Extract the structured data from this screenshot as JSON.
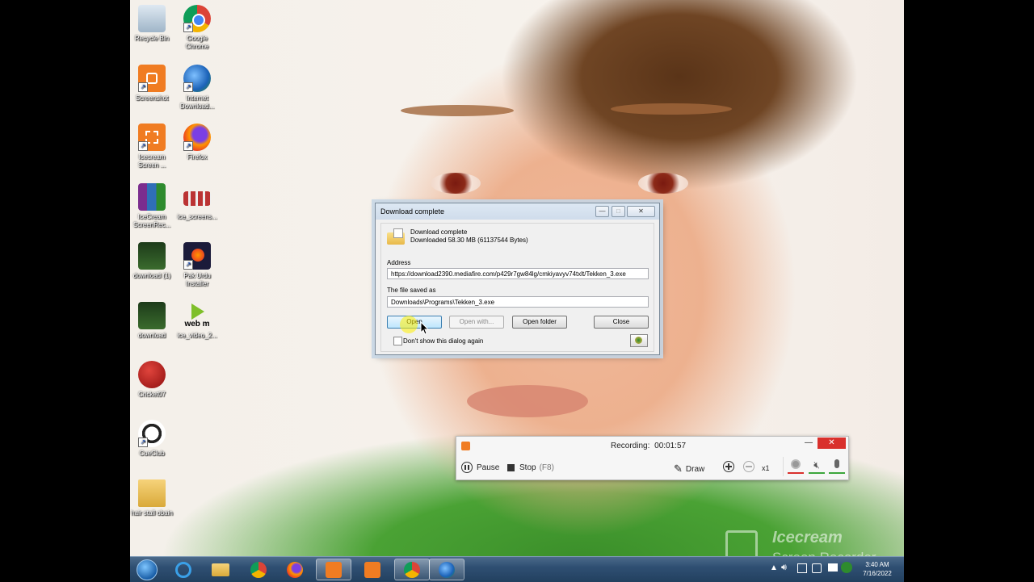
{
  "desktop": {
    "icons": [
      {
        "label": "Recycle Bin",
        "icon": "recycle-bin-icon"
      },
      {
        "label": "Google Chrome",
        "icon": "chrome-icon"
      },
      {
        "label": "Screenshot",
        "icon": "screenshot-icon"
      },
      {
        "label": "Internet Download...",
        "icon": "idm-icon"
      },
      {
        "label": "Icecream Screen ...",
        "icon": "icecream-icon"
      },
      {
        "label": "Firefox",
        "icon": "firefox-icon"
      },
      {
        "label": "IceCream ScreenRec...",
        "icon": "winrar-icon"
      },
      {
        "label": "ice_screens...",
        "icon": "ice-file-icon"
      },
      {
        "label": "download (1)",
        "icon": "image-thumb-icon"
      },
      {
        "label": "Pak Urdu Installer",
        "icon": "pak-urdu-icon"
      },
      {
        "label": "download",
        "icon": "image-thumb-icon"
      },
      {
        "label": "ice_video_2...",
        "icon": "webm-icon"
      },
      {
        "label": "Cricket07",
        "icon": "cricket-icon"
      },
      {
        "label": "CueClub",
        "icon": "cueclub-icon"
      },
      {
        "label": "hair stall obain",
        "icon": "folder-icon"
      }
    ],
    "webm_text": "web m"
  },
  "dialog": {
    "title": "Download complete",
    "header_title": "Download complete",
    "header_detail": "Downloaded 58.30  MB (61137544 Bytes)",
    "address_label": "Address",
    "address_value": "https://download2390.mediafire.com/p429r7gw84lg/cmkiyavyv74txlt/Tekken_3.exe",
    "saved_label": "The file saved as",
    "saved_value": "Downloads\\Programs\\Tekken_3.exe",
    "buttons": {
      "open": "Open",
      "open_with": "Open with...",
      "open_folder": "Open folder",
      "close": "Close"
    },
    "checkbox_label": "Don't show this dialog again",
    "checkbox_checked": false
  },
  "recorder": {
    "status_label": "Recording:",
    "time": "00:01:57",
    "pause": "Pause",
    "stop": "Stop",
    "stop_hotkey": "(F8)",
    "draw": "Draw",
    "zoom": "x1"
  },
  "taskbar": {
    "apps": [
      "start-orb",
      "internet-explorer",
      "file-explorer",
      "chrome",
      "firefox",
      "icecream-recorder",
      "screenshot",
      "chrome-alt",
      "idm"
    ],
    "active": [
      "icecream-recorder",
      "chrome-alt",
      "idm"
    ],
    "clock_time": "3:40 AM",
    "clock_date": "7/16/2022"
  },
  "watermark": {
    "line1": "Icecream",
    "line2": "Screen Recorder"
  },
  "colors": {
    "taskbar": "#2f4f72",
    "close_red": "#d9302c",
    "accent_orange": "#f07c22"
  }
}
